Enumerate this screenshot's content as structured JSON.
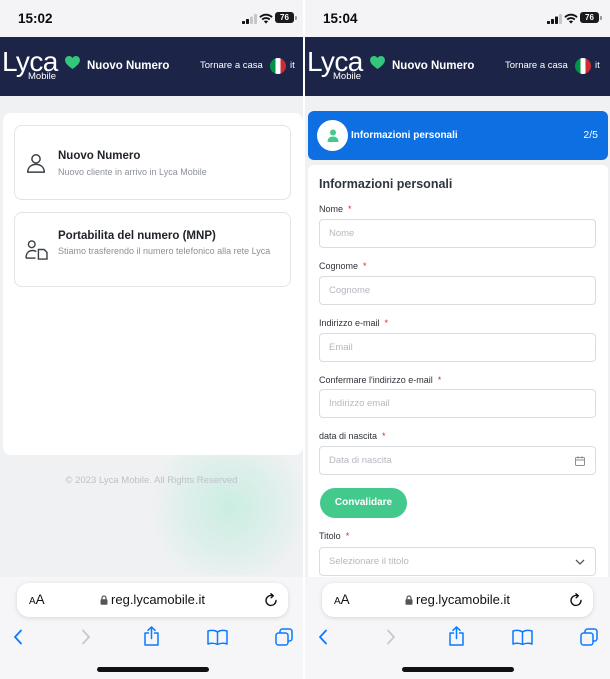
{
  "theme": {
    "navy": "#1c2548",
    "brand_green": "#34c77b",
    "step_blue": "#0d6fe1",
    "button_green": "#44c98c",
    "required_red": "#e0262d",
    "ios_blue": "#0a7aff",
    "flag_green": "#009246",
    "flag_white": "#ffffff",
    "flag_red": "#ce2b37"
  },
  "header": {
    "logo": "Lyca",
    "logo_sub": "Mobile",
    "title": "Nuovo Numero",
    "home_link": "Tornare a casa",
    "lang": "it"
  },
  "browser": {
    "text_size": "AA",
    "url": "reg.lycamobile.it"
  },
  "left": {
    "status": {
      "time": "15:02",
      "battery": "76",
      "signal_bars": 2
    },
    "options": [
      {
        "title": "Nuovo Numero",
        "description": "Nuovo cliente in arrivo in Lyca Mobile",
        "icon": "person-icon"
      },
      {
        "title": "Portabilita del numero (MNP)",
        "description": "Stiamo trasferendo il numero telefonico alla rete Lyca",
        "icon": "person-sim-icon"
      }
    ],
    "footer": "© 2023 Lyca Mobile. All Rights Reserved"
  },
  "right": {
    "status": {
      "time": "15:04",
      "battery": "76",
      "signal_bars": 3
    },
    "step": {
      "title": "Informazioni personali",
      "progress": "2/5"
    },
    "form": {
      "heading": "Informazioni personali",
      "required_mark": "*",
      "fields": [
        {
          "label": "Nome",
          "placeholder": "Nome"
        },
        {
          "label": "Cognome",
          "placeholder": "Cognome"
        },
        {
          "label": "Indirizzo e-mail",
          "placeholder": "Email"
        },
        {
          "label": "Confermare l'indirizzo e-mail",
          "placeholder": "Indirizzo email"
        },
        {
          "label": "data di nascita",
          "placeholder": "Data di nascita"
        }
      ],
      "submit_label": "Convalidare",
      "title_field": {
        "label": "Titolo",
        "placeholder": "Selezionare il titolo"
      }
    }
  }
}
